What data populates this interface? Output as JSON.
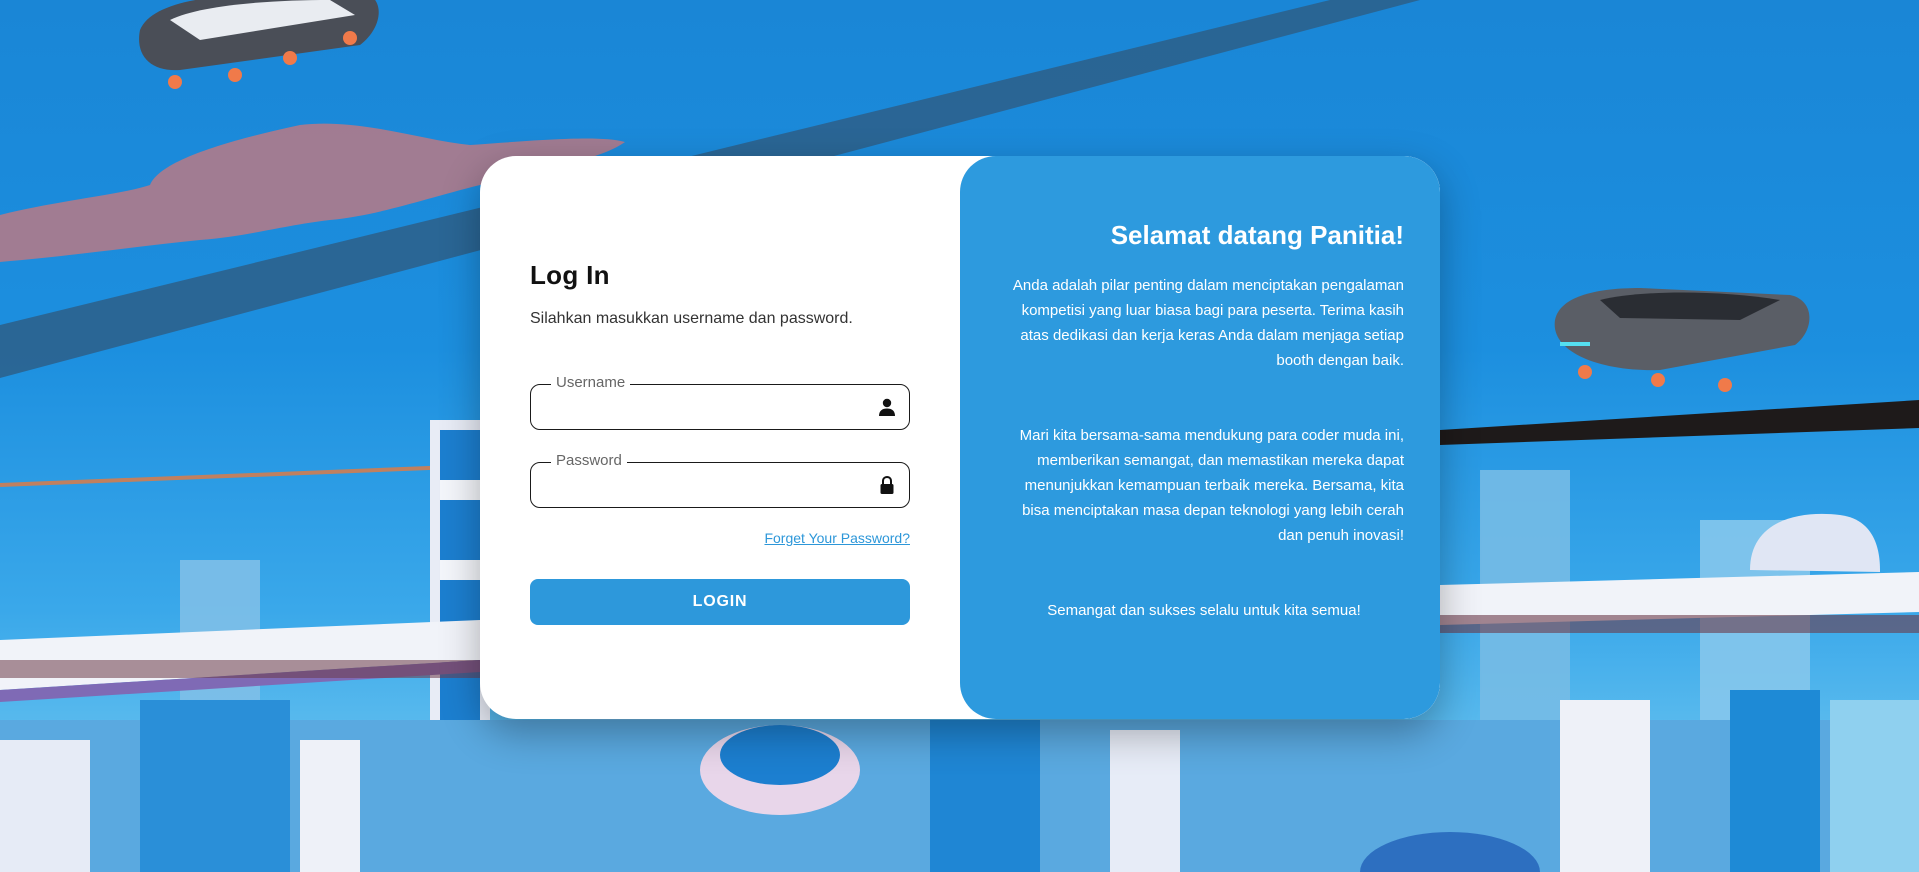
{
  "login": {
    "title": "Log In",
    "subtitle": "Silahkan masukkan username dan password.",
    "username_label": "Username",
    "username_value": "",
    "password_label": "Password",
    "password_value": "",
    "forgot_link": "Forget Your Password?",
    "login_button": "LOGIN"
  },
  "welcome": {
    "title": "Selamat datang Panitia!",
    "paragraph1": "Anda adalah pilar penting dalam menciptakan pengalaman kompetisi yang luar biasa bagi para peserta. Terima kasih atas dedikasi dan kerja keras Anda dalam menjaga setiap booth dengan baik.",
    "paragraph2": "Mari kita bersama-sama mendukung para coder muda ini, memberikan semangat, dan memastikan mereka dapat menunjukkan kemampuan terbaik mereka. Bersama, kita bisa menciptakan masa depan teknologi yang lebih cerah dan penuh inovasi!",
    "paragraph3": "Semangat dan sukses selalu untuk kita semua!"
  },
  "icons": {
    "username": "user-icon",
    "password": "lock-icon"
  },
  "colors": {
    "accent": "#2d98db",
    "panel": "#2d9ade",
    "sky": "#1a86d6"
  }
}
